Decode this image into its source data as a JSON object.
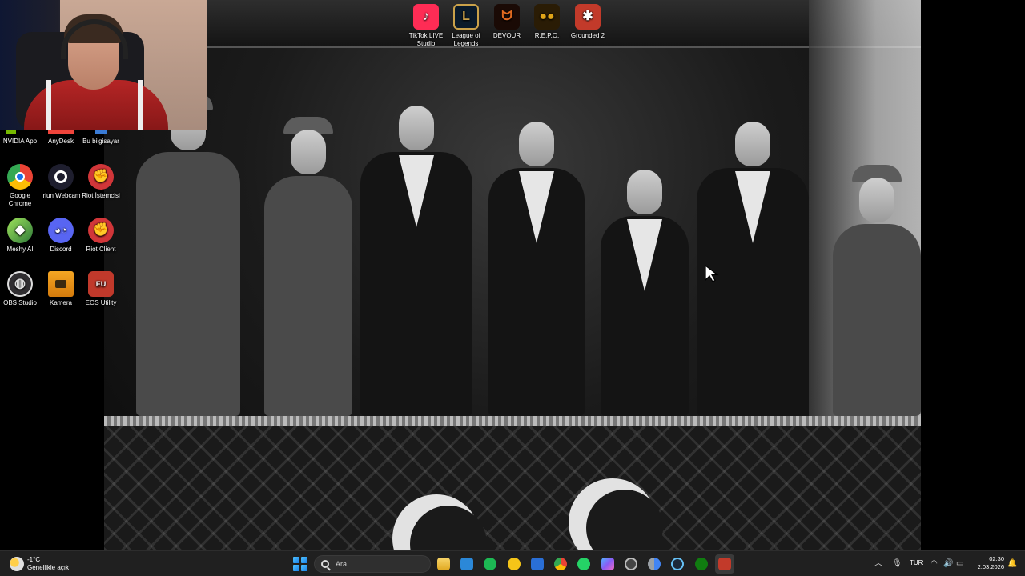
{
  "top_icons": [
    {
      "label": "TikTok LIVE Studio",
      "icon": "tiktok-live-icon",
      "color": "#fe2c55"
    },
    {
      "label": "League of Legends",
      "icon": "league-of-legends-icon",
      "color": "#c9a14a"
    },
    {
      "label": "DEVOUR",
      "icon": "devour-icon",
      "color": "#b04a14"
    },
    {
      "label": "R.E.P.O.",
      "icon": "repo-icon",
      "color": "#e0a418"
    },
    {
      "label": "Grounded 2",
      "icon": "grounded-2-icon",
      "color": "#c23a2a"
    }
  ],
  "side_icons": [
    {
      "label": "NVIDIA App",
      "icon": "nvidia-app-icon",
      "color": "#76b900"
    },
    {
      "label": "AnyDesk",
      "icon": "anydesk-icon",
      "color": "#ef443b"
    },
    {
      "label": "Bu bilgisayar",
      "icon": "this-pc-icon",
      "color": "#3a7bd5"
    },
    {
      "label": "Google Chrome",
      "icon": "chrome-icon",
      "color": "#1a73e8"
    },
    {
      "label": "Iriun Webcam",
      "icon": "iriun-webcam-icon",
      "color": "#1e1e2e"
    },
    {
      "label": "Riot İstemcisi",
      "icon": "riot-client-icon",
      "color": "#d13639"
    },
    {
      "label": "Meshy AI",
      "icon": "meshy-ai-icon",
      "color": "#3f8f3f"
    },
    {
      "label": "Discord",
      "icon": "discord-icon",
      "color": "#5865f2"
    },
    {
      "label": "Riot Client",
      "icon": "riot-client-icon-2",
      "color": "#d13639"
    },
    {
      "label": "OBS Studio",
      "icon": "obs-studio-icon",
      "color": "#302e31"
    },
    {
      "label": "Kamera",
      "icon": "camera-icon",
      "color": "#f5a623"
    },
    {
      "label": "EOS Utility",
      "icon": "eos-utility-icon",
      "color": "#c0392b"
    }
  ],
  "eos_badge": "EU",
  "taskbar": {
    "weather_temp": "-1°C",
    "weather_desc": "Genellikle açık",
    "search_placeholder": "Ara",
    "apps": [
      {
        "name": "file-explorer-icon",
        "color": "#f3c13a"
      },
      {
        "name": "microsoft-store-icon",
        "color": "#2b88d8"
      },
      {
        "name": "spotify-icon",
        "color": "#1db954"
      },
      {
        "name": "norton-icon",
        "color": "#f5c518"
      },
      {
        "name": "blue-app-icon",
        "color": "#2a6fd6"
      },
      {
        "name": "chrome-taskbar-icon",
        "color": "#ea4335"
      },
      {
        "name": "whatsapp-icon",
        "color": "#25d366"
      },
      {
        "name": "copilot-icon",
        "color": "#8a5cf5"
      },
      {
        "name": "obs-taskbar-icon",
        "color": "#444444"
      },
      {
        "name": "chrome-dev-icon",
        "color": "#4285f4"
      },
      {
        "name": "steam-icon",
        "color": "#1b2838"
      },
      {
        "name": "xbox-icon",
        "color": "#107c10"
      },
      {
        "name": "grounded-taskbar-icon",
        "color": "#c23a2a"
      }
    ],
    "language": "TUR",
    "time": "02:30",
    "date": "2.03.2026"
  }
}
